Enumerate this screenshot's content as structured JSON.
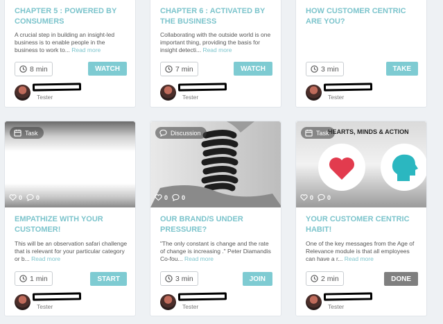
{
  "cards": [
    {
      "title": "CHAPTER 5 : POWERED BY CONSUMERS",
      "desc": "A crucial step in building an insight-led business is to enable people in the business to work to...",
      "more": "Read more",
      "duration": "8 min",
      "button": "WATCH",
      "author": "Tester"
    },
    {
      "title": "CHAPTER 6 : ACTIVATED BY THE BUSINESS",
      "desc": "Collaborating with the outside world is one important thing, providing the basis for insight detecti...",
      "more": "Read more",
      "duration": "7 min",
      "button": "WATCH",
      "author": "Tester"
    },
    {
      "title": "HOW CUSTOMER CENTRIC ARE YOU?",
      "desc": "",
      "more": "",
      "duration": "3 min",
      "button": "TAKE",
      "author": "Tester"
    },
    {
      "title": "EMPATHIZE WITH YOUR CUSTOMER!",
      "desc": "This will be an observation safari challenge that is relevant for your particular category or b...",
      "more": "Read more",
      "duration": "1 min",
      "button": "START",
      "author": "Tester",
      "tag": "Task",
      "likes": "0",
      "comments": "0"
    },
    {
      "title": "OUR BRAND/S UNDER PRESSURE?",
      "desc": "\"The only constant is change and the rate of change is increasing .\" Peter Diamandis Co-fou...",
      "more": "Read more",
      "duration": "3 min",
      "button": "JOIN",
      "author": "Tester",
      "tag": "Discussion",
      "likes": "0",
      "comments": "0"
    },
    {
      "title": "YOUR CUSTOMER CENTRIC HABIT!",
      "desc": "One of the key messages from the Age of Relevance module is that all employees can have a r...",
      "more": "Read more",
      "duration": "2 min",
      "button": "DONE",
      "author": "Tester",
      "tag": "Task",
      "likes": "0",
      "comments": "0",
      "image_text": "HEARTS, MINDS & ACTION"
    }
  ],
  "colors": {
    "accent": "#7cc4cc",
    "button": "#7ecbd2",
    "done": "#7f7f7f",
    "heart": "#e23b4e",
    "head": "#2bb7c0"
  }
}
